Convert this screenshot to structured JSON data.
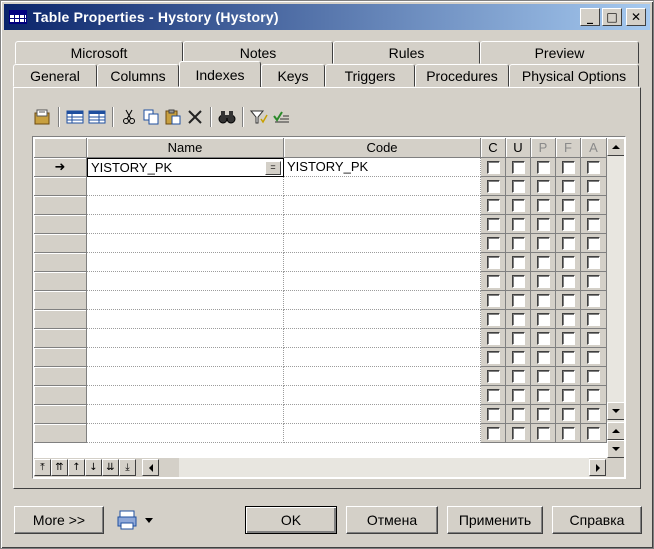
{
  "window": {
    "title": "Table Properties - Hystory (Hystory)",
    "buttons": {
      "minimize": "_",
      "maximize": "□",
      "close": "✕"
    }
  },
  "tabs": {
    "row_top": [
      "Microsoft",
      "Notes",
      "Rules",
      "Preview"
    ],
    "row_bottom": [
      "General",
      "Columns",
      "Indexes",
      "Keys",
      "Triggers",
      "Procedures",
      "Physical Options"
    ],
    "active": "Indexes"
  },
  "toolbar": {
    "icons": [
      "properties-icon",
      "add-row-icon",
      "insert-row-icon",
      "cut-icon",
      "copy-icon",
      "paste-icon",
      "delete-icon",
      "find-icon",
      "filter-icon",
      "check-icon"
    ]
  },
  "grid": {
    "columns": {
      "name": "Name",
      "code": "Code",
      "flags": [
        "C",
        "U",
        "P",
        "F",
        "A"
      ]
    },
    "rows": [
      {
        "current": true,
        "name": "YISTORY_PK",
        "code": "YISTORY_PK"
      }
    ],
    "empty_rows": 15,
    "row_marker": "➜",
    "ellipsis": "="
  },
  "buttons": {
    "more": "More >>",
    "ok": "OK",
    "cancel": "Отмена",
    "apply": "Применить",
    "help": "Справка"
  }
}
